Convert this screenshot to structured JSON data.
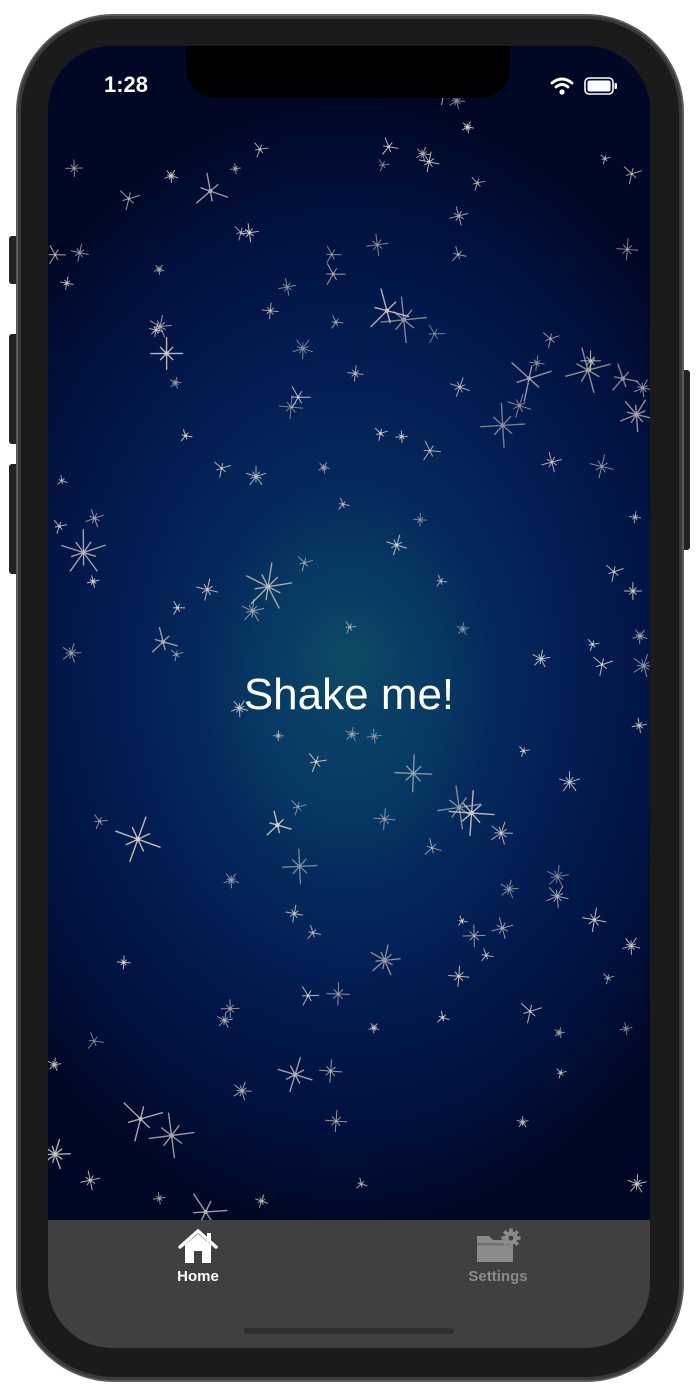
{
  "status_bar": {
    "time": "1:28",
    "icons": [
      "wifi-icon",
      "battery-icon"
    ]
  },
  "main": {
    "label": "Shake me!",
    "background": "starry-night-wallpaper"
  },
  "tab_bar": {
    "items": [
      {
        "label": "Home",
        "icon": "home-icon",
        "selected": true
      },
      {
        "label": "Settings",
        "icon": "folder-gear-icon",
        "selected": false
      }
    ]
  },
  "colors": {
    "tab_bar_bg": "#404040",
    "tab_active": "#ffffff",
    "tab_inactive": "#8a8a8a",
    "label": "#ffffff"
  }
}
